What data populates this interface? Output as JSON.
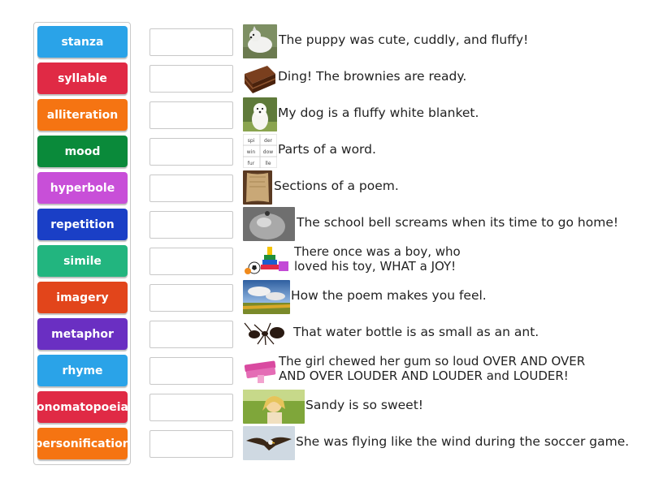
{
  "terms": [
    {
      "label": "stanza",
      "color": "#2aa3e8"
    },
    {
      "label": "syllable",
      "color": "#e02a45"
    },
    {
      "label": "alliteration",
      "color": "#f57412"
    },
    {
      "label": "mood",
      "color": "#0a8a3a"
    },
    {
      "label": "hyperbole",
      "color": "#c84fd8"
    },
    {
      "label": "repetition",
      "color": "#1a3fc6"
    },
    {
      "label": "simile",
      "color": "#22b57f"
    },
    {
      "label": "imagery",
      "color": "#e2451b"
    },
    {
      "label": "metaphor",
      "color": "#6a2fc2"
    },
    {
      "label": "rhyme",
      "color": "#2aa3e8"
    },
    {
      "label": "onomatopoeia",
      "color": "#e02a45"
    },
    {
      "label": "personification",
      "color": "#f57412"
    }
  ],
  "definitions": [
    {
      "icon": "puppy-image",
      "lines": [
        "The puppy was cute, cuddly, and fluffy!"
      ]
    },
    {
      "icon": "brownies-image",
      "lines": [
        "Ding! The brownies are ready."
      ]
    },
    {
      "icon": "white-dog-image",
      "lines": [
        "My dog is a fluffy white blanket."
      ]
    },
    {
      "icon": "syllable-chart-image",
      "chart_cells": [
        "spi",
        "der",
        "win",
        "dow",
        "fur",
        "lle"
      ],
      "lines": [
        "Parts of a word."
      ]
    },
    {
      "icon": "parchment-image",
      "lines": [
        "Sections of a poem."
      ]
    },
    {
      "icon": "bell-image",
      "lines": [
        "The school bell screams when its time to go home!"
      ]
    },
    {
      "icon": "toys-image",
      "lines": [
        "There once was a boy, who",
        "loved his toy, WHAT a JOY!"
      ]
    },
    {
      "icon": "sky-field-image",
      "lines": [
        "How the poem makes you feel."
      ]
    },
    {
      "icon": "ant-image",
      "lines": [
        "That water bottle is as small as an ant."
      ]
    },
    {
      "icon": "gum-image",
      "lines": [
        "The girl chewed her gum so loud OVER AND OVER",
        "AND OVER LOUDER AND LOUDER and LOUDER!"
      ]
    },
    {
      "icon": "girl-image",
      "lines": [
        "Sandy is so sweet!"
      ]
    },
    {
      "icon": "eagle-image",
      "lines": [
        "She was flying like the wind during the soccer game."
      ]
    }
  ]
}
